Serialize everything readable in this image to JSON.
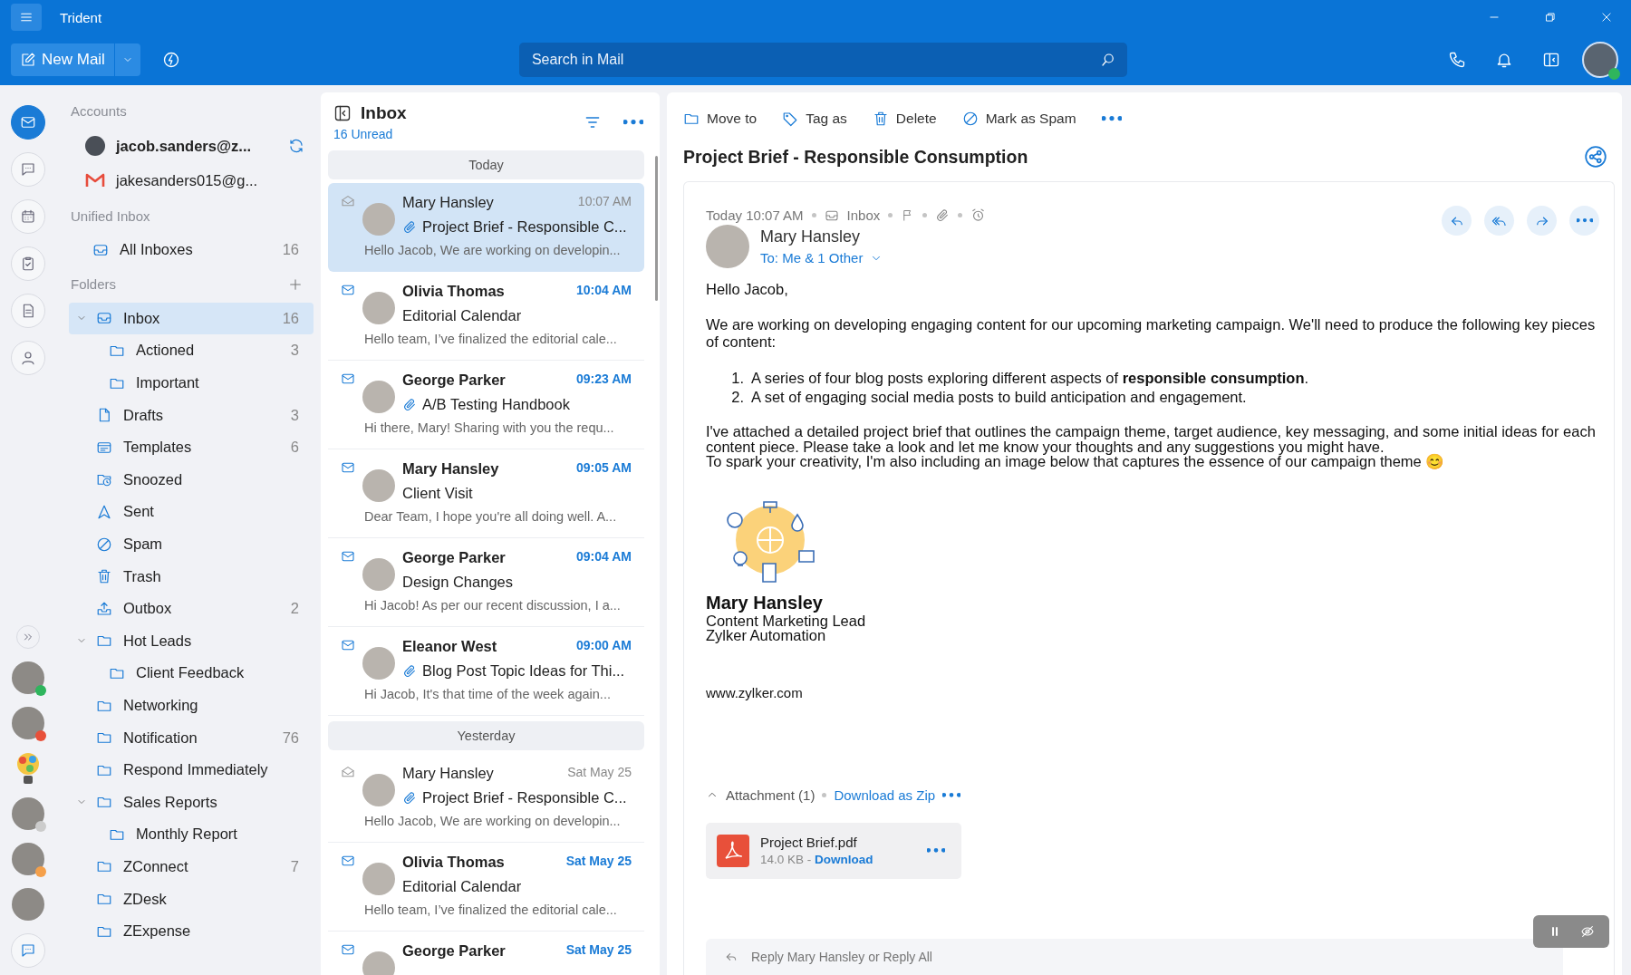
{
  "window": {
    "title": "Trident"
  },
  "toolbar": {
    "new_mail": "New Mail",
    "search": {
      "placeholder": "Search in Mail"
    }
  },
  "rail": {
    "apps": [
      {
        "kind": "mail",
        "selected": true
      },
      {
        "kind": "chat",
        "selected": false
      },
      {
        "kind": "calendar",
        "selected": false
      },
      {
        "kind": "tasks",
        "selected": false
      },
      {
        "kind": "notes",
        "selected": false
      },
      {
        "kind": "contacts",
        "selected": false
      }
    ],
    "contacts": [
      {
        "kind": "photo",
        "color": "#2fb55d"
      },
      {
        "kind": "photo",
        "color": "#e8503a"
      },
      {
        "kind": "bulb"
      },
      {
        "kind": "photo",
        "color": "#cccccc"
      },
      {
        "kind": "photo",
        "color": "#f5a04a"
      },
      {
        "kind": "photo"
      }
    ]
  },
  "accounts": {
    "label": "Accounts",
    "items": [
      {
        "kind": "zoho",
        "name": "jacob.sanders@z...",
        "selected": true
      },
      {
        "kind": "gmail",
        "name": "jakesanders015@g...",
        "selected": false
      }
    ]
  },
  "unified": {
    "label": "Unified Inbox",
    "items": [
      {
        "kind": "inbox",
        "label": "All Inboxes",
        "count": "16"
      }
    ]
  },
  "folders": {
    "label": "Folders",
    "items": [
      {
        "kind": "inbox",
        "label": "Inbox",
        "count": "16",
        "selected": true,
        "expanded": true,
        "children": [
          {
            "kind": "folder",
            "label": "Actioned",
            "count": "3",
            "selected": false
          },
          {
            "kind": "folder",
            "label": "Important",
            "selected": false
          }
        ]
      },
      {
        "kind": "drafts",
        "label": "Drafts",
        "count": "3",
        "selected": false
      },
      {
        "kind": "templates",
        "label": "Templates",
        "count": "6",
        "selected": false
      },
      {
        "kind": "snoozed",
        "label": "Snoozed",
        "selected": false
      },
      {
        "kind": "sent",
        "label": "Sent",
        "selected": false
      },
      {
        "kind": "spam",
        "label": "Spam",
        "selected": false
      },
      {
        "kind": "trash",
        "label": "Trash",
        "selected": false
      },
      {
        "kind": "outbox",
        "label": "Outbox",
        "count": "2",
        "selected": false
      },
      {
        "kind": "folder",
        "label": "Hot Leads",
        "selected": false,
        "expanded": true,
        "children": [
          {
            "kind": "folder",
            "label": "Client Feedback",
            "selected": false
          }
        ]
      },
      {
        "kind": "folder",
        "label": "Networking",
        "selected": false
      },
      {
        "kind": "folder",
        "label": "Notification",
        "count": "76",
        "selected": false
      },
      {
        "kind": "folder",
        "label": "Respond Immediately",
        "selected": false
      },
      {
        "kind": "folder",
        "label": "Sales Reports",
        "selected": false,
        "expanded": true,
        "children": [
          {
            "kind": "folder",
            "label": "Monthly Report",
            "selected": false
          }
        ]
      },
      {
        "kind": "folder",
        "label": "ZConnect",
        "count": "7",
        "selected": false
      },
      {
        "kind": "folder",
        "label": "ZDesk",
        "selected": false
      },
      {
        "kind": "folder",
        "label": "ZExpense",
        "selected": false
      }
    ]
  },
  "message_list": {
    "title": "Inbox",
    "unread_count": "16 Unread",
    "groups": [
      {
        "label": "Today",
        "messages": [
          {
            "sender": "Mary Hansley",
            "time": "10:07 AM",
            "subject": "Project Brief - Responsible C...",
            "preview": "Hello Jacob, We are working on developin...",
            "unread": false,
            "attachment": true,
            "selected": true
          },
          {
            "sender": "Olivia Thomas",
            "time": "10:04 AM",
            "subject": "Editorial Calendar",
            "preview": "Hello team, I’ve finalized the editorial cale...",
            "unread": true,
            "attachment": false,
            "selected": false
          },
          {
            "sender": "George Parker",
            "time": "09:23 AM",
            "subject": "A/B Testing Handbook",
            "preview": "Hi there, Mary! Sharing with you the requ...",
            "unread": true,
            "attachment": true,
            "selected": false
          },
          {
            "sender": "Mary Hansley",
            "time": "09:05 AM",
            "subject": "Client Visit",
            "preview": "Dear Team, I hope you're all doing well. A...",
            "unread": true,
            "attachment": false,
            "selected": false
          },
          {
            "sender": "George Parker",
            "time": "09:04 AM",
            "subject": "Design Changes",
            "preview": "Hi Jacob! As per our recent discussion, I a...",
            "unread": true,
            "attachment": false,
            "selected": false
          },
          {
            "sender": "Eleanor West",
            "time": "09:00 AM",
            "subject": "Blog Post Topic Ideas for Thi...",
            "preview": "Hi Jacob, It's that time of the week again...",
            "unread": true,
            "attachment": true,
            "selected": false
          }
        ]
      },
      {
        "label": "Yesterday",
        "messages": [
          {
            "sender": "Mary Hansley",
            "time": "Sat May 25",
            "subject": "Project Brief - Responsible C...",
            "preview": "Hello Jacob, We are working on developin...",
            "unread": false,
            "attachment": true,
            "selected": false
          },
          {
            "sender": "Olivia Thomas",
            "time": "Sat May 25",
            "subject": "Editorial Calendar",
            "preview": "Hello team, I’ve finalized the editorial cale...",
            "unread": true,
            "attachment": false,
            "selected": false
          },
          {
            "sender": "George Parker",
            "time": "Sat May 25",
            "unread": true,
            "selected": false
          }
        ]
      }
    ]
  },
  "reading": {
    "actions": [
      {
        "kind": "move",
        "label": "Move to"
      },
      {
        "kind": "tag",
        "label": "Tag as"
      },
      {
        "kind": "delete",
        "label": "Delete"
      },
      {
        "kind": "spam",
        "label": "Mark as Spam"
      }
    ],
    "subject": "Project Brief - Responsible Consumption",
    "meta": {
      "time": "Today 10:07 AM",
      "folder": "Inbox"
    },
    "sender": {
      "name": "Mary Hansley",
      "recipients": "To: Me & 1 Other"
    },
    "body": {
      "greeting": "Hello Jacob,",
      "intro": "We are working on developing engaging content for our upcoming marketing campaign. We'll need to produce the following key pieces of content:",
      "list": [
        {
          "marker": "1.",
          "text": "A series of four blog posts exploring different aspects of **responsible consumption**."
        },
        {
          "marker": "2.",
          "text": "A set of engaging social media posts to build anticipation and engagement."
        }
      ],
      "closing": [
        "I've attached a detailed project brief that outlines the campaign theme, target audience, key messaging, and some initial ideas for each content piece. Please take a look and let me know your thoughts and any suggestions you might have.",
        "To spark your creativity, I'm also including an image below that captures the essence of our campaign theme 😊"
      ]
    },
    "signature": {
      "name": "Mary Hansley",
      "title": "Content Marketing Lead",
      "company": "Zylker Automation",
      "website": "www.zylker.com"
    },
    "attachments": {
      "label": "Attachment (1)",
      "download_all": "Download as Zip",
      "files": [
        {
          "name": "Project Brief.pdf",
          "size": "14.0 KB -",
          "download": "Download"
        }
      ]
    },
    "reply": {
      "placeholder": "Reply Mary Hansley or Reply All"
    }
  }
}
